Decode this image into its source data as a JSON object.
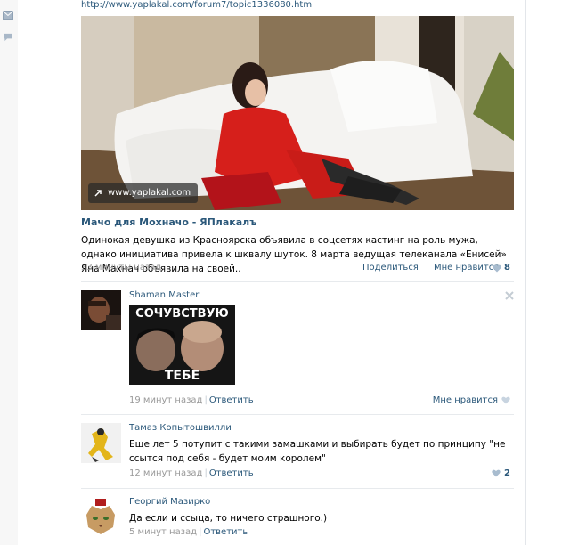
{
  "nav": {
    "icons": [
      "mail-icon",
      "chat-bubble-icon"
    ]
  },
  "post": {
    "url": "http://www.yaplakal.com/forum7/topic1336080.htm",
    "photo_badge": "www.yaplakal.com",
    "title": "Мачо для Мохначо - ЯПлакалъ",
    "description": "Одинокая девушка из Красноярска объявила в соцсетях кастинг на роль мужа, однако инициатива привела к шквалу шуток. 8 марта ведущая телеканала «Енисей» Яна Махнач объявила на своей..",
    "time": "33 минуты назад",
    "share_label": "Поделиться",
    "like_label": "Мне нравится",
    "like_count": "8"
  },
  "comments": [
    {
      "author": "Shaman Master",
      "meme_top": "СОЧУВСТВУЮ",
      "meme_bottom": "ТЕБЕ",
      "time": "19 минут назад",
      "reply_label": "Ответить",
      "like_label": "Мне нравится"
    },
    {
      "author": "Тамаз Копытошвилли",
      "text": "Еще лет 5 потупит с такими замашками и выбирать будет по принципу \"не ссытся под себя - будет моим королем\"",
      "time": "12 минут назад",
      "reply_label": "Ответить",
      "like_count": "2"
    },
    {
      "author": "Георгий Мазирко",
      "text": "Да если и ссыца, то ничего страшного.)",
      "time": "5 минут назад",
      "reply_label": "Ответить"
    }
  ],
  "colors": {
    "link": "#2b587a",
    "muted": "#999999",
    "heart": "#a8bccf"
  }
}
